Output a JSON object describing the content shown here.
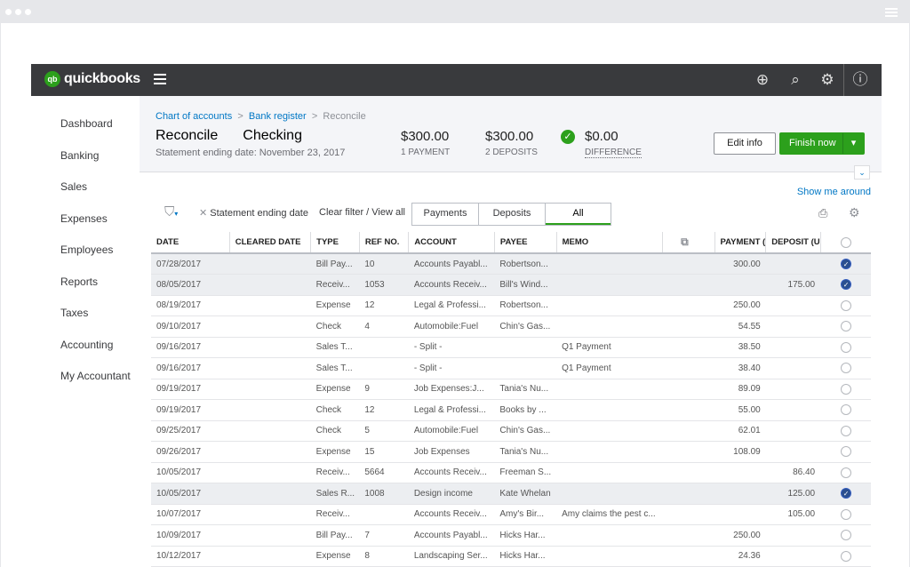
{
  "app": {
    "logo_small": "intuit",
    "logo": "quickbooks"
  },
  "sidebar": {
    "items": [
      "Dashboard",
      "Banking",
      "Sales",
      "Expenses",
      "Employees",
      "Reports",
      "Taxes",
      "Accounting",
      "My Accountant"
    ]
  },
  "breadcrumb": {
    "items": [
      "Chart of accounts",
      "Bank register",
      "Reconcile"
    ],
    "sep": ">"
  },
  "header": {
    "title": "Reconcile",
    "account": "Checking",
    "statement": "Statement ending date: November 23, 2017",
    "payments_value": "$300.00",
    "payments_label": "1 PAYMENT",
    "deposits_value": "$300.00",
    "deposits_label": "2 DEPOSITS",
    "difference_value": "$0.00",
    "difference_label": "DIFFERENCE",
    "edit_info": "Edit info",
    "finish_now": "Finish now"
  },
  "toolbar": {
    "show_me_around": "Show me around",
    "filter_chip": "Statement ending date",
    "clear_filter": "Clear filter / View all",
    "tabs": [
      "Payments",
      "Deposits",
      "All"
    ],
    "active_tab": "All"
  },
  "colors": {
    "accent": "#2ca01c",
    "link": "#0077c5",
    "appbar": "#393a3d"
  },
  "table": {
    "columns": [
      "DATE",
      "CLEARED DATE",
      "TYPE",
      "REF NO.",
      "ACCOUNT",
      "PAYEE",
      "MEMO",
      "",
      "PAYMENT (",
      "DEPOSIT (U",
      ""
    ],
    "rows": [
      [
        "07/28/2017",
        "",
        "Bill Pay...",
        "10",
        "Accounts Payabl...",
        "Robertson...",
        "",
        "300.00",
        "",
        true
      ],
      [
        "08/05/2017",
        "",
        "Receiv...",
        "1053",
        "Accounts Receiv...",
        "Bill's Wind...",
        "",
        "",
        "175.00",
        true
      ],
      [
        "08/19/2017",
        "",
        "Expense",
        "12",
        "Legal & Professi...",
        "Robertson...",
        "",
        "250.00",
        "",
        false
      ],
      [
        "09/10/2017",
        "",
        "Check",
        "4",
        "Automobile:Fuel",
        "Chin's Gas...",
        "",
        "54.55",
        "",
        false
      ],
      [
        "09/16/2017",
        "",
        "Sales T...",
        "",
        "- Split -",
        "",
        "Q1 Payment",
        "38.50",
        "",
        false
      ],
      [
        "09/16/2017",
        "",
        "Sales T...",
        "",
        "- Split -",
        "",
        "Q1 Payment",
        "38.40",
        "",
        false
      ],
      [
        "09/19/2017",
        "",
        "Expense",
        "9",
        "Job Expenses:J...",
        "Tania's Nu...",
        "",
        "89.09",
        "",
        false
      ],
      [
        "09/19/2017",
        "",
        "Check",
        "12",
        "Legal & Professi...",
        "Books by ...",
        "",
        "55.00",
        "",
        false
      ],
      [
        "09/25/2017",
        "",
        "Check",
        "5",
        "Automobile:Fuel",
        "Chin's Gas...",
        "",
        "62.01",
        "",
        false
      ],
      [
        "09/26/2017",
        "",
        "Expense",
        "15",
        "Job Expenses",
        "Tania's Nu...",
        "",
        "108.09",
        "",
        false
      ],
      [
        "10/05/2017",
        "",
        "Receiv...",
        "5664",
        "Accounts Receiv...",
        "Freeman S...",
        "",
        "",
        "86.40",
        false
      ],
      [
        "10/05/2017",
        "",
        "Sales R...",
        "1008",
        "Design income",
        "Kate Whelan",
        "",
        "",
        "125.00",
        true
      ],
      [
        "10/07/2017",
        "",
        "Receiv...",
        "",
        "Accounts Receiv...",
        "Amy's Bir...",
        "Amy claims the pest c...",
        "",
        "105.00",
        false
      ],
      [
        "10/09/2017",
        "",
        "Bill Pay...",
        "7",
        "Accounts Payabl...",
        "Hicks Har...",
        "",
        "250.00",
        "",
        false
      ],
      [
        "10/12/2017",
        "",
        "Expense",
        "8",
        "Landscaping Ser...",
        "Hicks Har...",
        "",
        "24.36",
        "",
        false
      ]
    ]
  }
}
